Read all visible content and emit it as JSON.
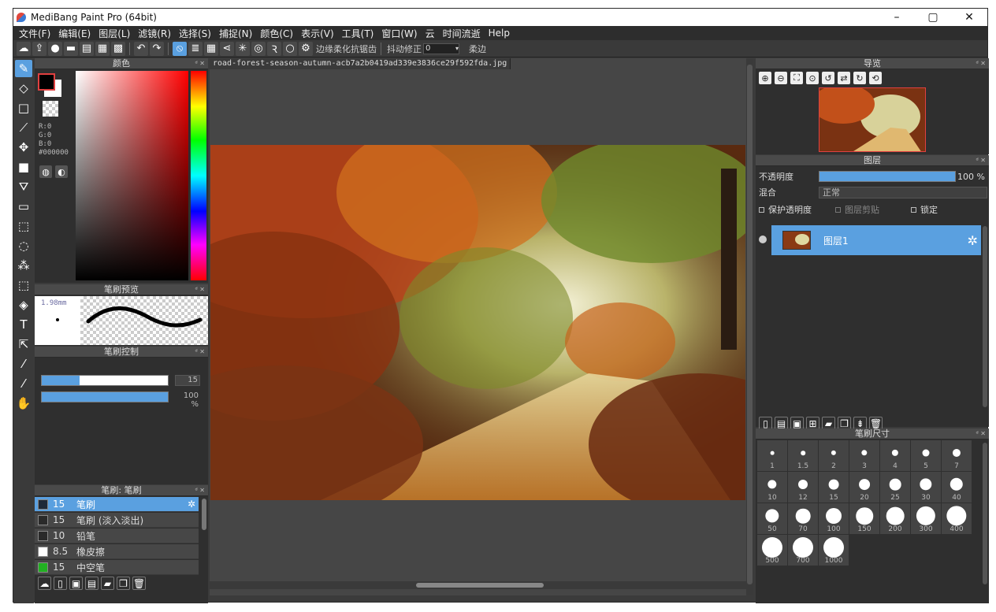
{
  "window": {
    "title": "MediBang Paint Pro (64bit)",
    "minimize": "–",
    "maximize": "▢",
    "close": "✕"
  },
  "menu": [
    "文件(F)",
    "编辑(E)",
    "图层(L)",
    "滤镜(R)",
    "选择(S)",
    "捕捉(N)",
    "颜色(C)",
    "表示(V)",
    "工具(T)",
    "窗口(W)",
    "云",
    "时间流逝",
    "Help"
  ],
  "toolbar": {
    "antialias_label": "边缘柔化抗锯齿",
    "stabilizer_label": "抖动修正",
    "stabilizer_value": "0",
    "soft_label": "柔边"
  },
  "color_panel": {
    "title": "颜色",
    "r": "R:0",
    "g": "G:0",
    "b": "B:0",
    "hex": "#000000"
  },
  "brush_preview": {
    "title": "笔刷预览",
    "size": "1.98mm"
  },
  "brush_control": {
    "title": "笔刷控制",
    "size_value": "15",
    "size_fraction": 0.3,
    "opacity_value": "100 %",
    "opacity_fraction": 1.0
  },
  "brush_list": {
    "title": "笔刷: 笔刷",
    "items": [
      {
        "size": "15",
        "name": "笔刷",
        "color": "#1e2a3a"
      },
      {
        "size": "15",
        "name": "笔刷 (淡入淡出)",
        "color": "#2a2a2a"
      },
      {
        "size": "10",
        "name": "铅笔",
        "color": "#2a2a2a"
      },
      {
        "size": "8.5",
        "name": "橡皮擦",
        "color": "#ffffff"
      },
      {
        "size": "15",
        "name": "中空笔",
        "color": "#22b022"
      }
    ]
  },
  "document": {
    "tab": "road-forest-season-autumn-acb7a2b0419ad339e3836ce29f592fda.jpg"
  },
  "navigator": {
    "title": "导览"
  },
  "layers": {
    "title": "图层",
    "opacity_label": "不透明度",
    "opacity_value": "100 %",
    "blend_label": "混合",
    "blend_value": "正常",
    "protect_label": "保护透明度",
    "clip_label": "图层剪贴",
    "lock_label": "锁定",
    "items": [
      {
        "name": "图层1"
      }
    ]
  },
  "brush_size": {
    "title": "笔刷尺寸",
    "sizes": [
      "1",
      "1.5",
      "2",
      "3",
      "4",
      "5",
      "7",
      "10",
      "12",
      "15",
      "20",
      "25",
      "30",
      "40",
      "50",
      "70",
      "100",
      "150",
      "200",
      "300",
      "400",
      "500",
      "700",
      "1000"
    ]
  },
  "colors": {
    "accent": "#5aa0e0",
    "panel": "#2f2f2f",
    "bg": "#3b3b3b"
  }
}
